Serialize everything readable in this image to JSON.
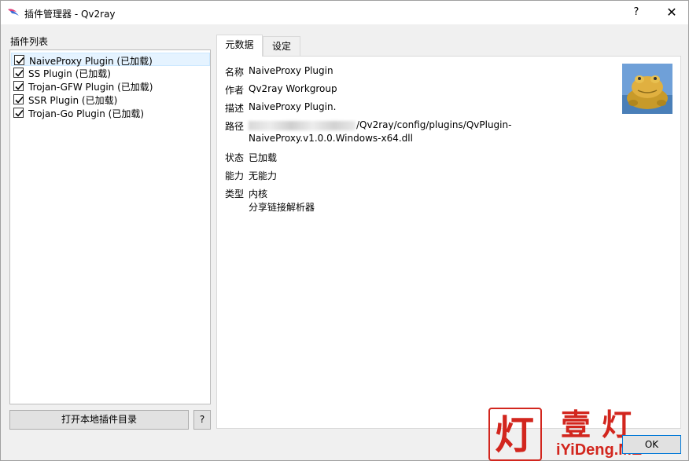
{
  "window": {
    "title": "插件管理器 - Qv2ray",
    "help_label": "?",
    "close_label": "✕"
  },
  "plugin_list": {
    "label": "插件列表",
    "items": [
      {
        "name": "NaiveProxy Plugin (已加载)",
        "checked": true,
        "selected": true
      },
      {
        "name": "SS Plugin (已加载)",
        "checked": true,
        "selected": false
      },
      {
        "name": "Trojan-GFW Plugin (已加载)",
        "checked": true,
        "selected": false
      },
      {
        "name": "SSR Plugin (已加载)",
        "checked": true,
        "selected": false
      },
      {
        "name": "Trojan-Go Plugin (已加载)",
        "checked": true,
        "selected": false
      }
    ],
    "open_dir_label": "打开本地插件目录",
    "help_label": "?"
  },
  "tabs": [
    {
      "label": "元数据",
      "active": true
    },
    {
      "label": "设定",
      "active": false
    }
  ],
  "metadata": {
    "name_label": "名称",
    "name_value": "NaiveProxy Plugin",
    "author_label": "作者",
    "author_value": "Qv2ray Workgroup",
    "desc_label": "描述",
    "desc_value": "NaiveProxy Plugin.",
    "path_label": "路径",
    "path_line1": "/Qv2ray/config/plugins/QvPlugin-",
    "path_line2": "NaiveProxy.v1.0.0.Windows-x64.dll",
    "state_label": "状态",
    "state_value": "已加载",
    "capability_label": "能力",
    "capability_value": "无能力",
    "type_label": "类型",
    "type_value_1": "内核",
    "type_value_2": "分享链接解析器"
  },
  "watermark": {
    "glyph": "灯",
    "title": "壹灯",
    "site": "iYiDeng.ME"
  },
  "ok_label": "OK",
  "icons": {
    "app": "qv2ray-app-icon",
    "plugin": "toad-plugin-icon",
    "check": "check-icon"
  }
}
